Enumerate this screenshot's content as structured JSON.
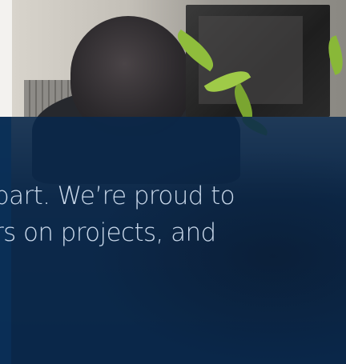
{
  "paragraph": {
    "line_1": "part. We’re proud to",
    "line_2": "rs on projects, and"
  },
  "colors": {
    "overlay": "#08284c",
    "text": "#c9d8ea",
    "leaf": "#8fbd3c"
  }
}
